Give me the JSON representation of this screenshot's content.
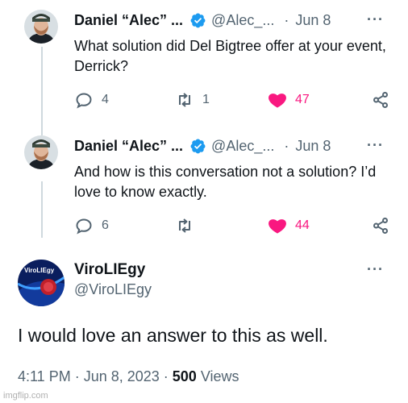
{
  "replies": [
    {
      "author_name": "Daniel “Alec” ...",
      "author_handle": "@Alec_...",
      "separator": "·",
      "date": "Jun 8",
      "text": "What solution did Del Bigtree offer at your event, Derrick?",
      "replies_count": "4",
      "retweets_count": "1",
      "likes_count": "47",
      "more_label": "···"
    },
    {
      "author_name": "Daniel “Alec” ...",
      "author_handle": "@Alec_...",
      "separator": "·",
      "date": "Jun 8",
      "text": "And how is this conversation not a solution? I’d love to know exactly.",
      "replies_count": "6",
      "retweets_count": "",
      "likes_count": "44",
      "more_label": "···"
    }
  ],
  "main_tweet": {
    "author_name": "ViroLIEgy",
    "author_handle": "@ViroLIEgy",
    "avatar_text": "ViroLIEgy",
    "more_label": "···",
    "text": "I would love an answer to this as well.",
    "timestamp": "4:11 PM · Jun 8, 2023 · ",
    "views_count": "500",
    "views_label": " Views"
  },
  "watermark": "imgflip.com",
  "colors": {
    "verified_blue": "#1d9bf0",
    "like_pink": "#f91880",
    "secondary_text": "#536471",
    "thread_line": "#cfd9de"
  },
  "icons": {
    "reply": "reply-icon",
    "retweet": "retweet-icon",
    "like": "heart-icon",
    "share": "share-icon",
    "verified": "verified-badge-icon",
    "more": "more-icon"
  }
}
